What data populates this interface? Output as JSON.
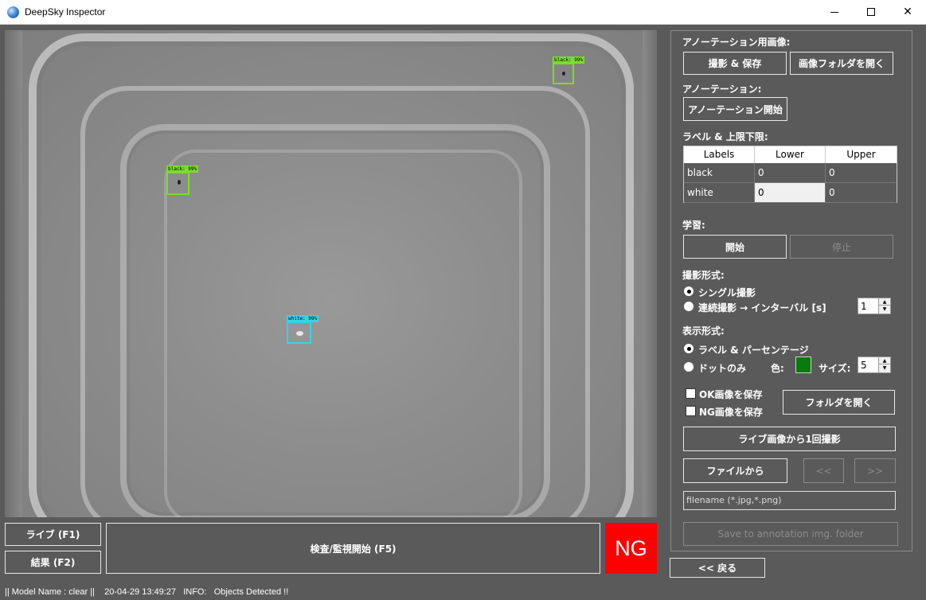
{
  "window": {
    "title": "DeepSky Inspector"
  },
  "viewer": {
    "detections": [
      {
        "label": "black: 99%",
        "class": "black"
      },
      {
        "label": "black: 99%",
        "class": "black"
      },
      {
        "label": "white: 99%",
        "class": "white"
      }
    ]
  },
  "bottom": {
    "live_button": "ライブ (F1)",
    "result_button": "結果 (F2)",
    "inspect_button": "検査/監視開始 (F5)",
    "result_status": "NG",
    "back_button": "<< 戻る"
  },
  "panel": {
    "annotation_images_header": "アノーテーション用画像:",
    "capture_save_button": "撮影 & 保存",
    "open_image_folder_button": "画像フォルダを開く",
    "annotation_header": "アノーテーション:",
    "start_annotation_button": "アノーテーション開始",
    "labels_limits_header": "ラベル & 上限下限:",
    "table": {
      "columns": [
        "Labels",
        "Lower",
        "Upper"
      ],
      "rows": [
        [
          "black",
          "0",
          "0"
        ],
        [
          "white",
          "0",
          "0"
        ]
      ]
    },
    "learning_header": "学習:",
    "start_button": "開始",
    "stop_button": "停止",
    "capture_mode_header": "撮影形式:",
    "single_capture_label": "シングル撮影",
    "continuous_capture_label": "連続撮影 → インターバル [s]",
    "interval_value": "1",
    "display_mode_header": "表示形式:",
    "label_percent_label": "ラベル & パーセンテージ",
    "dots_only_label": "ドットのみ",
    "color_label": "色:",
    "color_value": "#0a7a0a",
    "size_label": "サイズ:",
    "size_value": "5",
    "save_ok_label": "OK画像を保存",
    "save_ng_label": "NG画像を保存",
    "open_folder_button": "フォルダを開く",
    "capture_once_button": "ライブ画像から1回撮影",
    "from_file_button": "ファイルから",
    "prev_button": "<<",
    "next_button": ">>",
    "filename_placeholder": "filename (*.jpg,*.png)",
    "save_to_annotation_button": "Save to annotation img. folder"
  },
  "statusbar": {
    "text": "|| Model Name : clear ||    20-04-29 13:49:27   INFO:   Objects Detected !!"
  }
}
